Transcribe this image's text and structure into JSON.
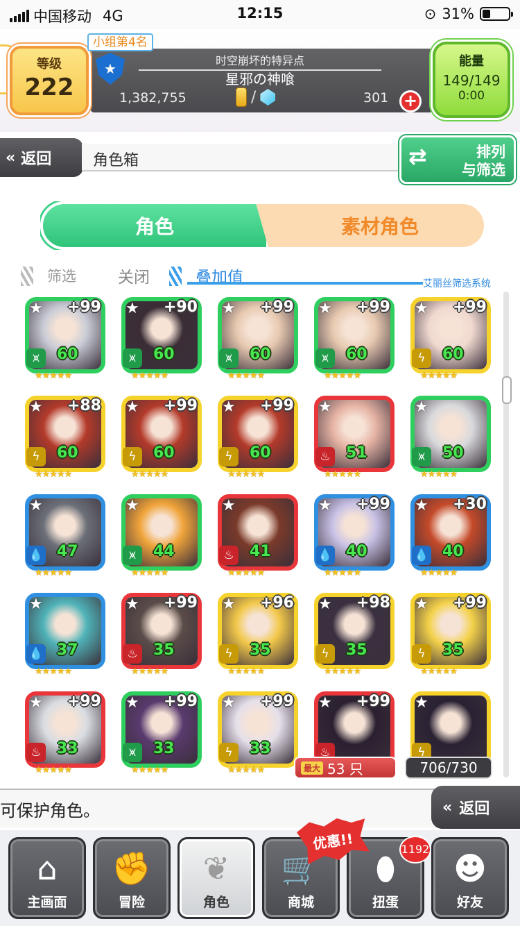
{
  "status": {
    "carrier": "中国移动",
    "network": "4G",
    "time": "12:15",
    "battery": "31%"
  },
  "header": {
    "level_label": "等级",
    "level": "222",
    "rank": "小组第4名",
    "quest_sub": "时空崩坏的特异点",
    "quest_title": "星邪の神喰",
    "coins": "1,382,755",
    "separator": "/",
    "gems": "301",
    "plus": "+",
    "energy_label": "能量",
    "energy": "149/149",
    "energy_timer": "0:00"
  },
  "nav": {
    "back": "返回",
    "title": "角色箱",
    "sort_line1": "排列",
    "sort_line2": "与筛选"
  },
  "tabs": {
    "active": "角色",
    "inactive": "素材角色"
  },
  "filter": {
    "filter_label": "筛选",
    "filter_state": "关闭",
    "stack_label": "叠加值",
    "system": "艾丽丝筛选系统"
  },
  "cards": [
    {
      "plus": "+99",
      "lvl": "60",
      "frame": "#2ecf5e",
      "elem": "wind",
      "art": "#c9ccd6"
    },
    {
      "plus": "+90",
      "lvl": "60",
      "frame": "#2ecf5e",
      "elem": "wind",
      "art": "#3a2d36"
    },
    {
      "plus": "+99",
      "lvl": "60",
      "frame": "#2ecf5e",
      "elem": "wind",
      "art": "#e7c9b0"
    },
    {
      "plus": "+99",
      "lvl": "60",
      "frame": "#2ecf5e",
      "elem": "wind",
      "art": "#e7c9b0"
    },
    {
      "plus": "+99",
      "lvl": "60",
      "frame": "#f6d22c",
      "elem": "thunder",
      "art": "#f0d8cf"
    },
    {
      "plus": "+88",
      "lvl": "60",
      "frame": "#f6d22c",
      "elem": "thunder",
      "art": "#b33a2a"
    },
    {
      "plus": "+99",
      "lvl": "60",
      "frame": "#f6d22c",
      "elem": "thunder",
      "art": "#b33a2a"
    },
    {
      "plus": "+99",
      "lvl": "60",
      "frame": "#f6d22c",
      "elem": "thunder",
      "art": "#b33a2a"
    },
    {
      "plus": "",
      "lvl": "51",
      "frame": "#e8363a",
      "elem": "fire",
      "art": "#e6b3a4"
    },
    {
      "plus": "",
      "lvl": "50",
      "frame": "#2ecf5e",
      "elem": "wind",
      "art": "#d9d9dc"
    },
    {
      "plus": "",
      "lvl": "47",
      "frame": "#2f8fe0",
      "elem": "water",
      "art": "#6b6f78"
    },
    {
      "plus": "",
      "lvl": "44",
      "frame": "#2ecf5e",
      "elem": "wind",
      "art": "#f0a43a"
    },
    {
      "plus": "",
      "lvl": "41",
      "frame": "#e8363a",
      "elem": "fire",
      "art": "#7a3a2a"
    },
    {
      "plus": "+99",
      "lvl": "40",
      "frame": "#2f8fe0",
      "elem": "water",
      "art": "#c9c2e6"
    },
    {
      "plus": "+30",
      "lvl": "40",
      "frame": "#2f8fe0",
      "elem": "water",
      "art": "#c44a2a"
    },
    {
      "plus": "",
      "lvl": "37",
      "frame": "#2f8fe0",
      "elem": "water",
      "art": "#4fb3b8"
    },
    {
      "plus": "+99",
      "lvl": "35",
      "frame": "#e8363a",
      "elem": "fire",
      "art": "#5a4c48"
    },
    {
      "plus": "+96",
      "lvl": "35",
      "frame": "#f6d22c",
      "elem": "thunder",
      "art": "#f2c84a"
    },
    {
      "plus": "+98",
      "lvl": "35",
      "frame": "#f6d22c",
      "elem": "thunder",
      "art": "#3a3040"
    },
    {
      "plus": "+99",
      "lvl": "35",
      "frame": "#f6d22c",
      "elem": "thunder",
      "art": "#f4d24a"
    },
    {
      "plus": "+99",
      "lvl": "33",
      "frame": "#e8363a",
      "elem": "fire",
      "art": "#d9dde2"
    },
    {
      "plus": "+99",
      "lvl": "33",
      "frame": "#2ecf5e",
      "elem": "wind",
      "art": "#5a3a6e"
    },
    {
      "plus": "+99",
      "lvl": "33",
      "frame": "#f6d22c",
      "elem": "thunder",
      "art": "#e6e0ea"
    },
    {
      "plus": "+99",
      "lvl": "",
      "frame": "#e8363a",
      "elem": "fire",
      "art": "#2a2030"
    },
    {
      "plus": "",
      "lvl": "",
      "frame": "#f6d22c",
      "elem": "thunder",
      "art": "#2a2233"
    }
  ],
  "element_glyphs": {
    "wind": "⩙",
    "thunder": "ϟ",
    "fire": "♨",
    "water": "💧"
  },
  "element_colors": {
    "wind": "#1f9b4a",
    "thunder": "#c79a08",
    "fire": "#c8242a",
    "water": "#1f6fc9"
  },
  "max_label": "最大",
  "max_count": "53 只",
  "box_count": "706/730",
  "message": "可保护角色。",
  "back2": "返回",
  "sale": "优惠!!",
  "notification": "1192",
  "bottom_nav": [
    {
      "label": "主画面",
      "icon": "home-icon",
      "glyph": "⌂",
      "active": false
    },
    {
      "label": "冒险",
      "icon": "fist-icon",
      "glyph": "✊",
      "active": false
    },
    {
      "label": "角色",
      "icon": "bunny-icon",
      "glyph": "❦",
      "active": true
    },
    {
      "label": "商城",
      "icon": "cart-icon",
      "glyph": "🛒",
      "active": false
    },
    {
      "label": "扭蛋",
      "icon": "egg-icon",
      "glyph": "⬮",
      "active": false
    },
    {
      "label": "好友",
      "icon": "friends-icon",
      "glyph": "☻",
      "active": false
    }
  ]
}
